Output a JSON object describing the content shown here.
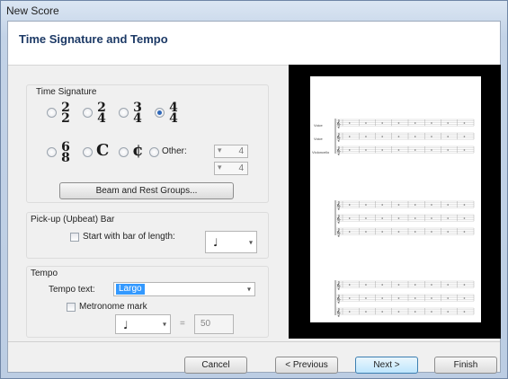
{
  "window": {
    "title": "New Score"
  },
  "page": {
    "title": "Time Signature and Tempo"
  },
  "time_signature": {
    "group_label": "Time Signature",
    "options": [
      {
        "top": "2",
        "bottom": "2",
        "selected": false
      },
      {
        "top": "2",
        "bottom": "4",
        "selected": false
      },
      {
        "top": "3",
        "bottom": "4",
        "selected": false
      },
      {
        "top": "4",
        "bottom": "4",
        "selected": true
      },
      {
        "top": "6",
        "bottom": "8",
        "selected": false
      }
    ],
    "common_symbol": "C",
    "cut_symbol": "¢",
    "other_label": "Other:",
    "other_top": "4",
    "other_bottom": "4",
    "beam_button": "Beam and Rest Groups..."
  },
  "pickup": {
    "group_label": "Pick-up (Upbeat) Bar",
    "checkbox_label": "Start with bar of length:"
  },
  "tempo": {
    "group_label": "Tempo",
    "tempo_text_label": "Tempo text:",
    "tempo_text_value": "Largo",
    "metronome_label": "Metronome mark",
    "equals": "=",
    "bpm_value": "50"
  },
  "preview": {
    "staff_labels": [
      "Voice",
      "Voice",
      "Violoncello"
    ]
  },
  "footer": {
    "cancel": "Cancel",
    "previous": "< Previous",
    "next": "Next >",
    "finish": "Finish"
  }
}
